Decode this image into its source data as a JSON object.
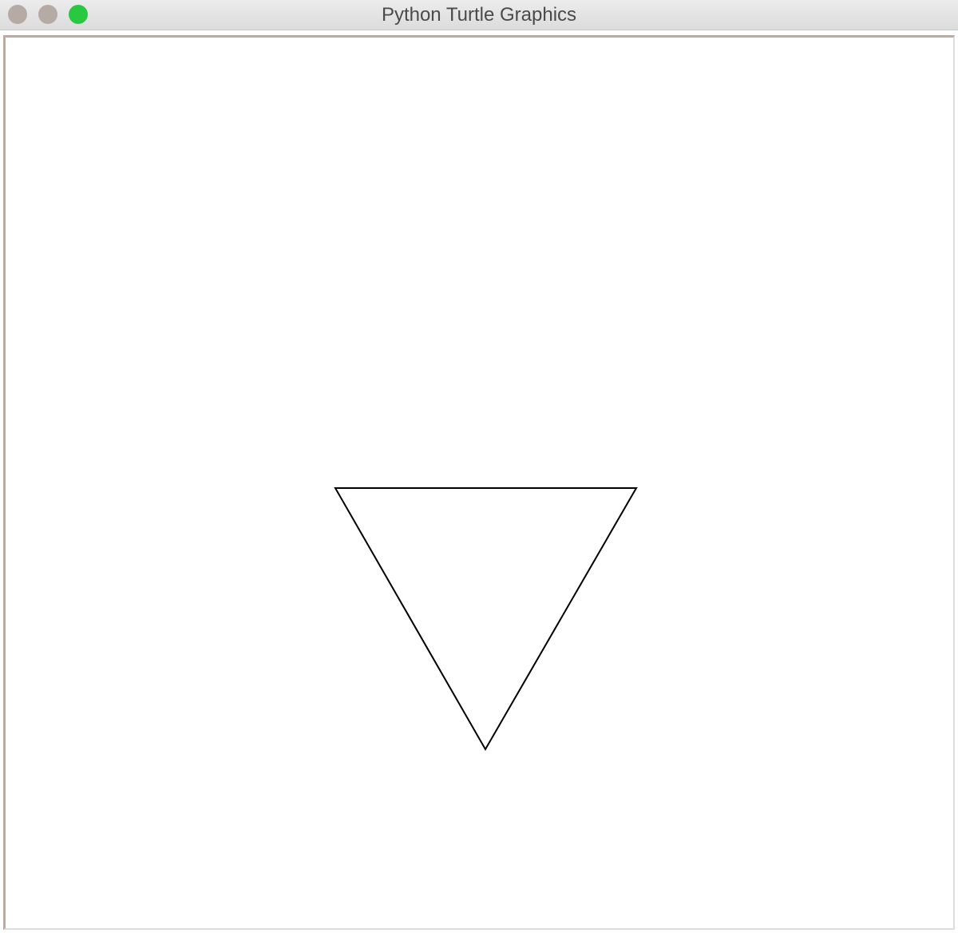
{
  "window": {
    "title": "Python Turtle Graphics",
    "controls": {
      "close_color": "#b5aaa4",
      "minimize_color": "#b5aaa4",
      "zoom_color": "#28c840"
    }
  },
  "canvas": {
    "background_color": "#ffffff",
    "drawing": {
      "shape": "triangle",
      "orientation": "pointing-down",
      "stroke_color": "#000000",
      "fill_color": "none"
    }
  }
}
